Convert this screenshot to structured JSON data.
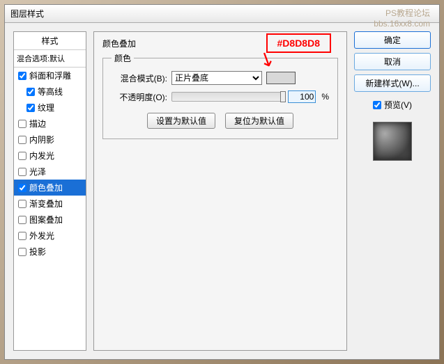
{
  "titlebar": "图层样式",
  "watermark": {
    "line1": "PS教程论坛",
    "line2": "bbs.16xx8.com"
  },
  "styles": {
    "header": "样式",
    "blend_options": "混合选项:默认",
    "items": [
      {
        "label": "斜面和浮雕",
        "checked": true,
        "indent": false
      },
      {
        "label": "等高线",
        "checked": true,
        "indent": true
      },
      {
        "label": "纹理",
        "checked": true,
        "indent": true
      },
      {
        "label": "描边",
        "checked": false,
        "indent": false
      },
      {
        "label": "内阴影",
        "checked": false,
        "indent": false
      },
      {
        "label": "内发光",
        "checked": false,
        "indent": false
      },
      {
        "label": "光泽",
        "checked": false,
        "indent": false
      },
      {
        "label": "颜色叠加",
        "checked": true,
        "indent": false,
        "selected": true
      },
      {
        "label": "渐变叠加",
        "checked": false,
        "indent": false
      },
      {
        "label": "图案叠加",
        "checked": false,
        "indent": false
      },
      {
        "label": "外发光",
        "checked": false,
        "indent": false
      },
      {
        "label": "投影",
        "checked": false,
        "indent": false
      }
    ]
  },
  "main": {
    "title": "颜色叠加",
    "fieldset": "颜色",
    "blend_mode_label": "混合模式(B):",
    "blend_mode_value": "正片叠底",
    "opacity_label": "不透明度(O):",
    "opacity_value": "100",
    "pct": "%",
    "default_btn": "设置为默认值",
    "reset_btn": "复位为默认值",
    "annotation": "#D8D8D8",
    "swatch_color": "#D8D8D8"
  },
  "right": {
    "ok": "确定",
    "cancel": "取消",
    "new_style": "新建样式(W)...",
    "preview": "预览(V)"
  }
}
